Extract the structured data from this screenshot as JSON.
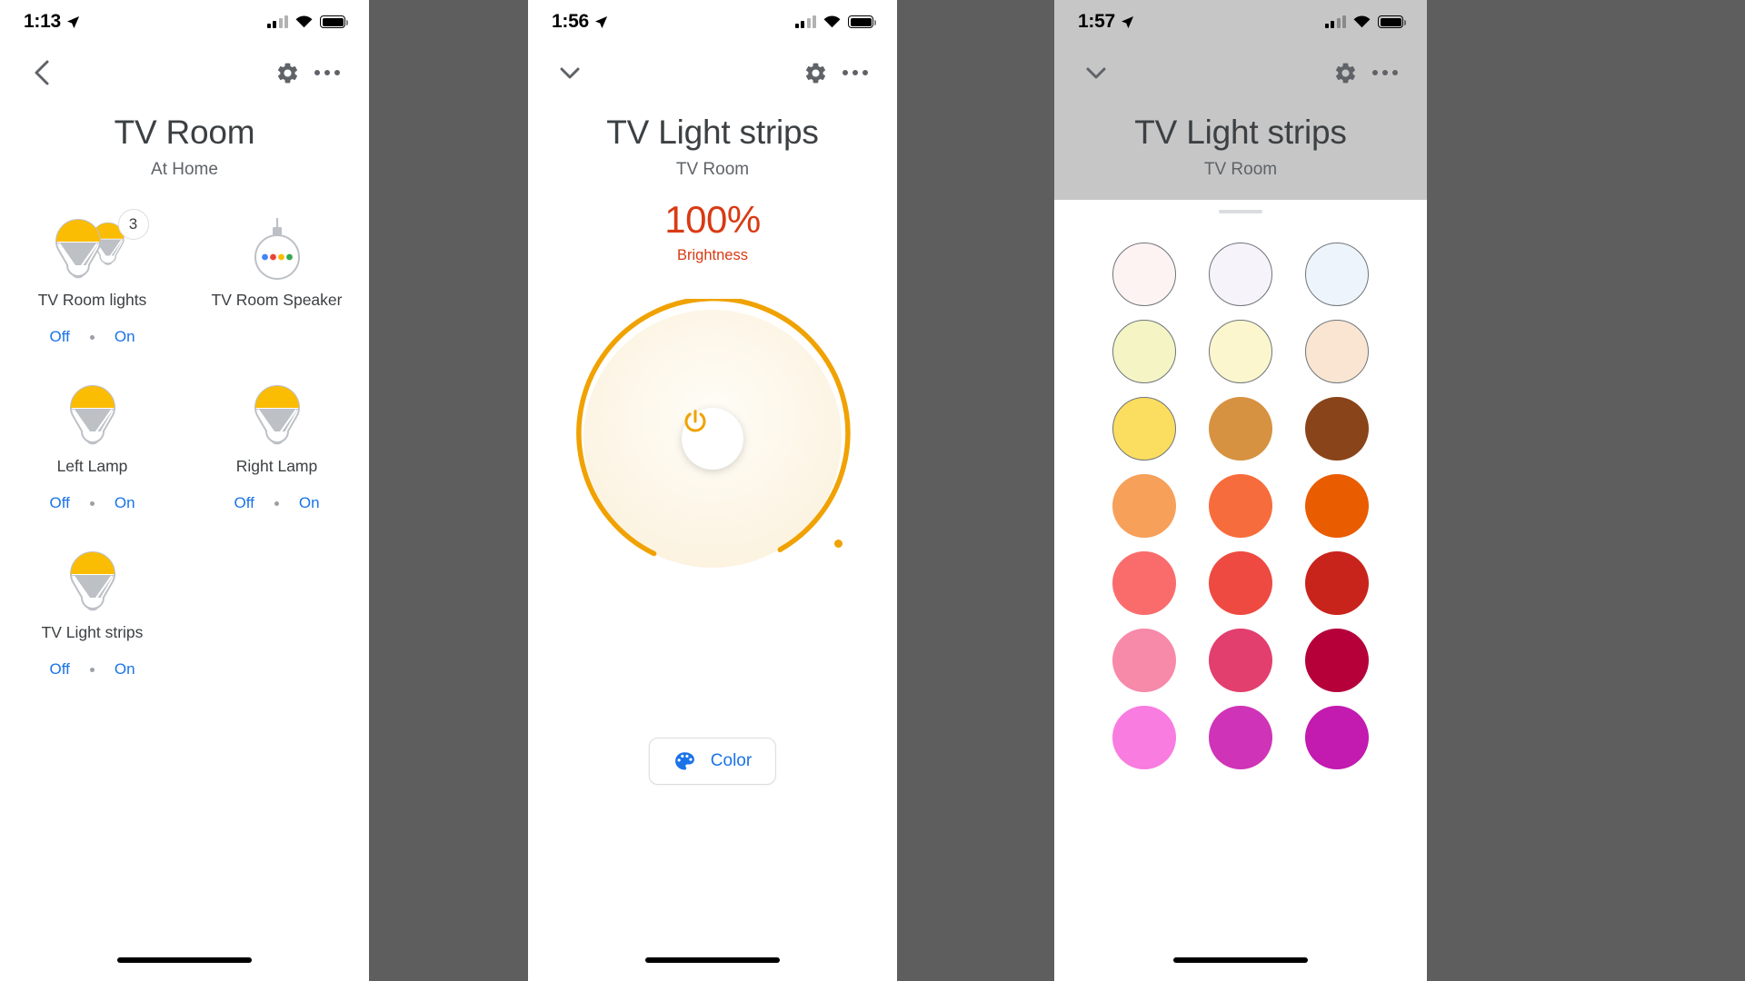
{
  "accent_blue": "#1a73e8",
  "accent_orange": "#f0a202",
  "accent_red": "#d93a13",
  "panels": {
    "room": {
      "status": {
        "time": "1:13",
        "location_icon": "location-arrow-icon"
      },
      "nav": {
        "back": "back-chevron-icon",
        "settings": "gear-icon",
        "more": "more-options-icon"
      },
      "title": "TV Room",
      "subtitle": "At Home",
      "devices": [
        {
          "name": "TV Room lights",
          "icon": "bulb-group-icon",
          "badge": "3",
          "off_label": "Off",
          "on_label": "On"
        },
        {
          "name": "TV Room Speaker",
          "icon": "speaker-icon",
          "badge": null,
          "off_label": null,
          "on_label": null
        },
        {
          "name": "Left Lamp",
          "icon": "bulb-icon",
          "badge": null,
          "off_label": "Off",
          "on_label": "On"
        },
        {
          "name": "Right Lamp",
          "icon": "bulb-icon",
          "badge": null,
          "off_label": "Off",
          "on_label": "On"
        },
        {
          "name": "TV Light strips",
          "icon": "bulb-icon",
          "badge": null,
          "off_label": "Off",
          "on_label": "On"
        }
      ]
    },
    "light": {
      "status": {
        "time": "1:56",
        "location_icon": "location-arrow-icon"
      },
      "nav": {
        "back": "chevron-down-icon",
        "settings": "gear-icon",
        "more": "more-options-icon"
      },
      "title": "TV Light strips",
      "subtitle": "TV Room",
      "dial": {
        "percent": "100%",
        "percent_label": "Brightness",
        "power_icon": "power-icon",
        "ring_color": "#f0a202",
        "value": 100
      },
      "color_button": {
        "label": "Color",
        "icon": "palette-icon"
      }
    },
    "color": {
      "status": {
        "time": "1:57",
        "location_icon": "location-arrow-icon"
      },
      "nav": {
        "back": "chevron-down-icon",
        "settings": "gear-icon",
        "more": "more-options-icon"
      },
      "title": "TV Light strips",
      "subtitle": "TV Room",
      "swatches": [
        {
          "name": "swatch-soft-blush",
          "hex": "#fdf3f3",
          "outlined": true
        },
        {
          "name": "swatch-soft-lavender",
          "hex": "#f6f3fa",
          "outlined": true
        },
        {
          "name": "swatch-soft-ice-blue",
          "hex": "#eef4fb",
          "outlined": true
        },
        {
          "name": "swatch-pale-yellow",
          "hex": "#f4f4c5",
          "outlined": true
        },
        {
          "name": "swatch-cream",
          "hex": "#fbf6cd",
          "outlined": true
        },
        {
          "name": "swatch-peach-cream",
          "hex": "#f9e5d2",
          "outlined": true
        },
        {
          "name": "swatch-golden-yellow",
          "hex": "#fbdd5f",
          "outlined": true
        },
        {
          "name": "swatch-amber",
          "hex": "#d69240",
          "outlined": false
        },
        {
          "name": "swatch-brown",
          "hex": "#8a441a",
          "outlined": false
        },
        {
          "name": "swatch-light-orange",
          "hex": "#f6a05a",
          "outlined": false
        },
        {
          "name": "swatch-orange",
          "hex": "#f76c3c",
          "outlined": false
        },
        {
          "name": "swatch-deep-orange",
          "hex": "#e95c00",
          "outlined": false
        },
        {
          "name": "swatch-salmon",
          "hex": "#fa6c6c",
          "outlined": false
        },
        {
          "name": "swatch-red",
          "hex": "#ee4a42",
          "outlined": false
        },
        {
          "name": "swatch-dark-red",
          "hex": "#c9241c",
          "outlined": false
        },
        {
          "name": "swatch-pink",
          "hex": "#f789a9",
          "outlined": false
        },
        {
          "name": "swatch-rose",
          "hex": "#e23e6e",
          "outlined": false
        },
        {
          "name": "swatch-crimson",
          "hex": "#b5003a",
          "outlined": false
        },
        {
          "name": "swatch-light-magenta",
          "hex": "#f97ce0",
          "outlined": false
        },
        {
          "name": "swatch-magenta",
          "hex": "#cf33b7",
          "outlined": false
        },
        {
          "name": "swatch-purple-magenta",
          "hex": "#c31ab0",
          "outlined": false
        }
      ]
    }
  }
}
